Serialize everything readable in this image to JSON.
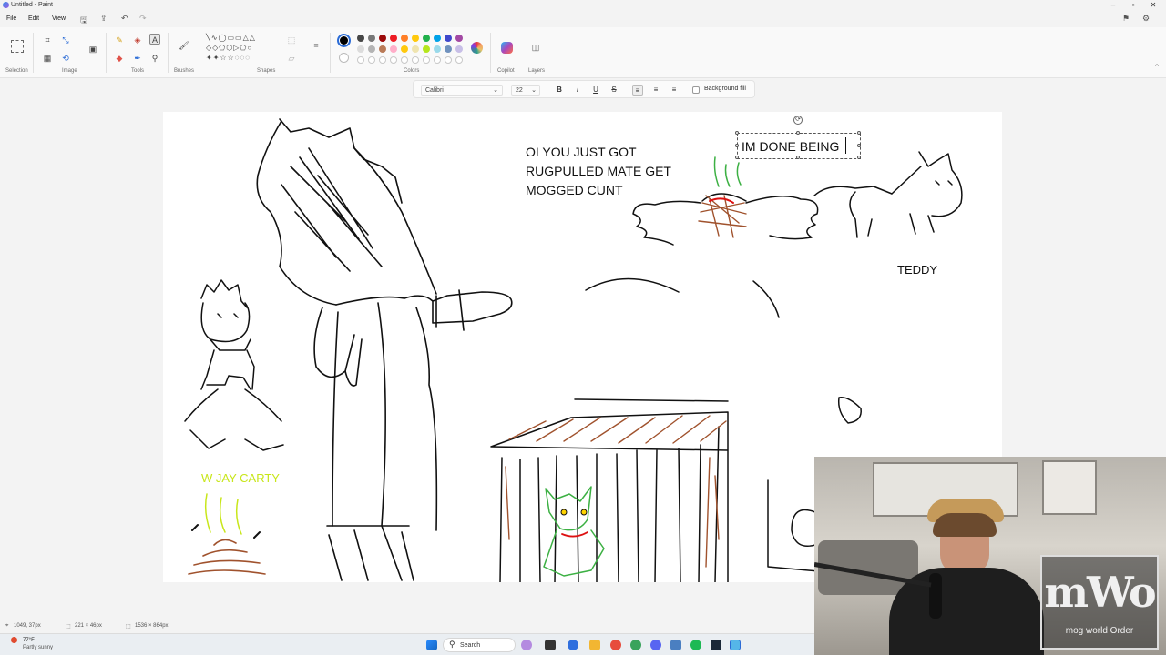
{
  "window": {
    "title": "Untitled - Paint"
  },
  "menu": [
    "File",
    "Edit",
    "View"
  ],
  "ribbon": {
    "groups": {
      "selection": "Selection",
      "image": "Image",
      "tools": "Tools",
      "brushes": "Brushes",
      "shapes": "Shapes",
      "colors": "Colors",
      "copilot": "Copilot",
      "layers": "Layers"
    },
    "palette_row1": [
      "#000000",
      "#464646",
      "#787878",
      "#9c0a0a",
      "#ed1c24",
      "#ff7f27",
      "#ffc90e",
      "#22b14c",
      "#00a2e8",
      "#3f48cc",
      "#a349a4"
    ],
    "palette_row2": [
      "#ffffff",
      "#dcdcdc",
      "#b4b4b4",
      "#b97a57",
      "#ffaec9",
      "#ffc90e",
      "#efe4b0",
      "#b5e61d",
      "#99d9ea",
      "#7092be",
      "#c8bfe7"
    ],
    "active_color": "#000000"
  },
  "text_toolbar": {
    "font": "Calibri",
    "size": "22",
    "bold": "B",
    "italic": "I",
    "underline": "U",
    "strike": "S",
    "background_fill": "Background fill"
  },
  "canvas": {
    "texts": {
      "main_caption": [
        "OI YOU JUST GOT",
        "RUGPULLED MATE GET",
        "MOGGED CUNT"
      ],
      "active_textbox": "IM DONE BEING",
      "teddy": "TEDDY",
      "w_jay": "W JAY CARTY"
    }
  },
  "status": {
    "cursor": "1049, 37px",
    "selection": "221 × 46px",
    "canvas_size": "1536 × 864px"
  },
  "taskbar": {
    "weather_temp": "77°F",
    "weather_desc": "Partly sunny",
    "search": "Search"
  },
  "webcam": {
    "logo_big": "mWo",
    "logo_small": "mog world Order"
  }
}
